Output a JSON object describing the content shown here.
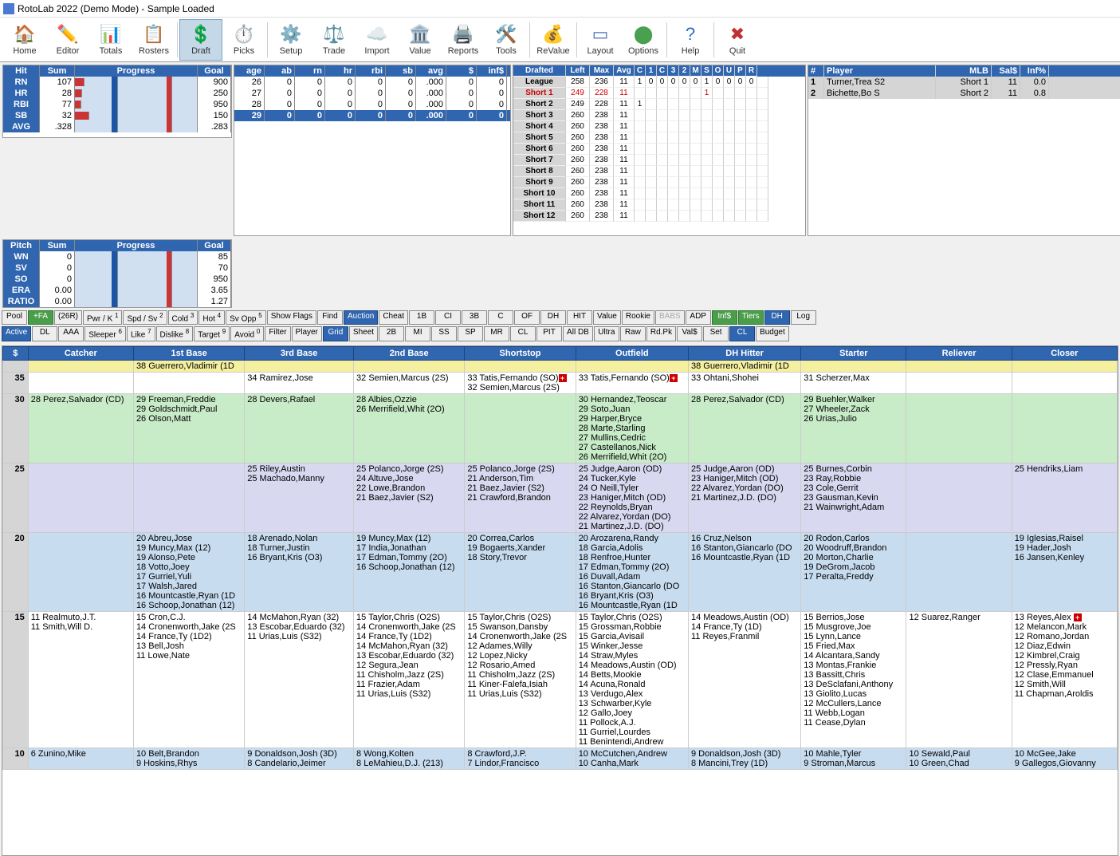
{
  "title": "RotoLab 2022 (Demo Mode) - Sample Loaded",
  "toolbar": [
    "Home",
    "Editor",
    "Totals",
    "Rosters",
    "Draft",
    "Picks",
    "Setup",
    "Trade",
    "Import",
    "Value",
    "Reports",
    "Tools",
    "ReValue",
    "Layout",
    "Options",
    "Help",
    "Quit"
  ],
  "hit": {
    "hdr": [
      "Hit",
      "Sum",
      "Progress",
      "Goal"
    ],
    "rows": [
      {
        "l": "RN",
        "s": "107",
        "g": "900",
        "p": 8
      },
      {
        "l": "HR",
        "s": "28",
        "g": "250",
        "p": 6
      },
      {
        "l": "RBI",
        "s": "77",
        "g": "950",
        "p": 5
      },
      {
        "l": "SB",
        "s": "32",
        "g": "150",
        "p": 12
      },
      {
        "l": "AVG",
        "s": ".328",
        "g": ".283",
        "p": 0
      }
    ]
  },
  "pitch": {
    "hdr": [
      "Pitch",
      "Sum",
      "Progress",
      "Goal"
    ],
    "rows": [
      {
        "l": "WN",
        "s": "0",
        "g": "85"
      },
      {
        "l": "SV",
        "s": "0",
        "g": "70"
      },
      {
        "l": "SO",
        "s": "0",
        "g": "950"
      },
      {
        "l": "ERA",
        "s": "0.00",
        "g": "3.65"
      },
      {
        "l": "RATIO",
        "s": "0.00",
        "g": "1.27"
      }
    ]
  },
  "age": {
    "hdr": [
      "age",
      "ab",
      "rn",
      "hr",
      "rbi",
      "sb",
      "avg",
      "$",
      "inf$"
    ],
    "rows": [
      [
        "26",
        "0",
        "0",
        "0",
        "0",
        "0",
        ".000",
        "0",
        "0"
      ],
      [
        "27",
        "0",
        "0",
        "0",
        "0",
        "0",
        ".000",
        "0",
        "0"
      ],
      [
        "28",
        "0",
        "0",
        "0",
        "0",
        "0",
        ".000",
        "0",
        "0"
      ]
    ],
    "total": [
      "29",
      "0",
      "0",
      "0",
      "0",
      "0",
      ".000",
      "0",
      "0"
    ]
  },
  "draft": {
    "hdr": [
      "Drafted",
      "Left",
      "Max",
      "Avg",
      "C",
      "1",
      "C",
      "3",
      "2",
      "M",
      "S",
      "O",
      "U",
      "P",
      "R"
    ],
    "rows": [
      {
        "l": "League",
        "c": "",
        "v": [
          "258",
          "236",
          "11",
          "1",
          "0",
          "0",
          "0",
          "0",
          "0",
          "1",
          "0",
          "0",
          "0",
          "0",
          ""
        ]
      },
      {
        "l": "Short 1",
        "c": "short",
        "v": [
          "249",
          "228",
          "11",
          "",
          "",
          "",
          "",
          "",
          "",
          "1",
          "",
          "",
          "",
          "",
          ""
        ]
      },
      {
        "l": "Short 2",
        "c": "",
        "v": [
          "249",
          "228",
          "11",
          "1",
          "",
          "",
          "",
          "",
          "",
          "",
          "",
          "",
          "",
          "",
          ""
        ]
      },
      {
        "l": "Short 3",
        "c": "",
        "v": [
          "260",
          "238",
          "11",
          "",
          "",
          "",
          "",
          "",
          "",
          "",
          "",
          "",
          "",
          "",
          ""
        ]
      },
      {
        "l": "Short 4",
        "c": "",
        "v": [
          "260",
          "238",
          "11",
          "",
          "",
          "",
          "",
          "",
          "",
          "",
          "",
          "",
          "",
          "",
          ""
        ]
      },
      {
        "l": "Short 5",
        "c": "",
        "v": [
          "260",
          "238",
          "11",
          "",
          "",
          "",
          "",
          "",
          "",
          "",
          "",
          "",
          "",
          "",
          ""
        ]
      },
      {
        "l": "Short 6",
        "c": "",
        "v": [
          "260",
          "238",
          "11",
          "",
          "",
          "",
          "",
          "",
          "",
          "",
          "",
          "",
          "",
          "",
          ""
        ]
      },
      {
        "l": "Short 7",
        "c": "",
        "v": [
          "260",
          "238",
          "11",
          "",
          "",
          "",
          "",
          "",
          "",
          "",
          "",
          "",
          "",
          "",
          ""
        ]
      },
      {
        "l": "Short 8",
        "c": "",
        "v": [
          "260",
          "238",
          "11",
          "",
          "",
          "",
          "",
          "",
          "",
          "",
          "",
          "",
          "",
          "",
          ""
        ]
      },
      {
        "l": "Short 9",
        "c": "",
        "v": [
          "260",
          "238",
          "11",
          "",
          "",
          "",
          "",
          "",
          "",
          "",
          "",
          "",
          "",
          "",
          ""
        ]
      },
      {
        "l": "Short 10",
        "c": "",
        "v": [
          "260",
          "238",
          "11",
          "",
          "",
          "",
          "",
          "",
          "",
          "",
          "",
          "",
          "",
          "",
          ""
        ]
      },
      {
        "l": "Short 11",
        "c": "",
        "v": [
          "260",
          "238",
          "11",
          "",
          "",
          "",
          "",
          "",
          "",
          "",
          "",
          "",
          "",
          "",
          ""
        ]
      },
      {
        "l": "Short 12",
        "c": "",
        "v": [
          "260",
          "238",
          "11",
          "",
          "",
          "",
          "",
          "",
          "",
          "",
          "",
          "",
          "",
          "",
          ""
        ]
      }
    ]
  },
  "players": {
    "hdr": [
      "#",
      "Player",
      "MLB",
      "Sal$",
      "Inf%"
    ],
    "rows": [
      [
        "1",
        "Turner,Trea  S2",
        "Short 1",
        "11",
        "0.0"
      ],
      [
        "2",
        "Bichette,Bo  S",
        "Short 2",
        "11",
        "0.8"
      ]
    ]
  },
  "filters": {
    "r1": [
      {
        "t": "Pool",
        "c": ""
      },
      {
        "t": "+FA",
        "c": "green"
      },
      {
        "t": "(26R)",
        "c": ""
      },
      {
        "t": "Pwr / K",
        "c": "",
        "sup": "1"
      },
      {
        "t": "Spd / Sv",
        "c": "",
        "sup": "2"
      },
      {
        "t": "Cold",
        "c": "",
        "sup": "3"
      },
      {
        "t": "Hot",
        "c": "",
        "sup": "4"
      },
      {
        "t": "Sv Opp",
        "c": "",
        "sup": "5"
      },
      {
        "t": "Show Flags",
        "c": ""
      },
      {
        "t": "Find",
        "c": ""
      },
      {
        "t": "Auction",
        "c": "blue"
      },
      {
        "t": "Cheat",
        "c": ""
      },
      {
        "t": "1B",
        "c": ""
      },
      {
        "t": "CI",
        "c": ""
      },
      {
        "t": "3B",
        "c": ""
      },
      {
        "t": "C",
        "c": ""
      },
      {
        "t": "OF",
        "c": ""
      },
      {
        "t": "DH",
        "c": ""
      },
      {
        "t": "HIT",
        "c": ""
      },
      {
        "t": "Value",
        "c": ""
      },
      {
        "t": "Rookie",
        "c": ""
      },
      {
        "t": "BABS",
        "c": "dim"
      },
      {
        "t": "ADP",
        "c": ""
      },
      {
        "t": "Inf$",
        "c": "green"
      },
      {
        "t": "Tiers",
        "c": "green"
      },
      {
        "t": "DH",
        "c": "blue"
      },
      {
        "t": "Log",
        "c": ""
      }
    ],
    "r2": [
      {
        "t": "Active",
        "c": "blue"
      },
      {
        "t": "DL",
        "c": ""
      },
      {
        "t": "AAA",
        "c": ""
      },
      {
        "t": "Sleeper",
        "c": "",
        "sup": "6"
      },
      {
        "t": "Like",
        "c": "",
        "sup": "7"
      },
      {
        "t": "Dislike",
        "c": "",
        "sup": "8"
      },
      {
        "t": "Target",
        "c": "",
        "sup": "9"
      },
      {
        "t": "Avoid",
        "c": "",
        "sup": "0"
      },
      {
        "t": "Filter",
        "c": ""
      },
      {
        "t": "Player",
        "c": ""
      },
      {
        "t": "Grid",
        "c": "blue"
      },
      {
        "t": "Sheet",
        "c": ""
      },
      {
        "t": "2B",
        "c": ""
      },
      {
        "t": "MI",
        "c": ""
      },
      {
        "t": "SS",
        "c": ""
      },
      {
        "t": "SP",
        "c": ""
      },
      {
        "t": "MR",
        "c": ""
      },
      {
        "t": "CL",
        "c": ""
      },
      {
        "t": "PIT",
        "c": ""
      },
      {
        "t": "All DB",
        "c": ""
      },
      {
        "t": "Ultra",
        "c": ""
      },
      {
        "t": "Raw",
        "c": ""
      },
      {
        "t": "Rd.Pk",
        "c": ""
      },
      {
        "t": "Val$",
        "c": ""
      },
      {
        "t": "Set",
        "c": ""
      },
      {
        "t": "CL",
        "c": "blue"
      },
      {
        "t": "Budget",
        "c": ""
      }
    ]
  },
  "tiers": {
    "hdr": [
      "$",
      "Catcher",
      "1st Base",
      "3rd Base",
      "2nd Base",
      "Shortstop",
      "Outfield",
      "DH Hitter",
      "Starter",
      "Reliever",
      "Closer"
    ],
    "rows": [
      {
        "p": "",
        "cls": "bg-yel",
        "c": [
          "",
          "38 Guerrero,Vladimir (1D",
          "",
          "",
          "",
          "",
          "38 Guerrero,Vladimir (1D",
          "",
          "",
          ""
        ]
      },
      {
        "p": "35",
        "cls": "",
        "c": [
          "",
          "",
          "34 Ramirez,Jose",
          "32 Semien,Marcus (2S)",
          "33 Tatis,Fernando (SO)✚\n32 Semien,Marcus (2S)",
          "33 Tatis,Fernando (SO)✚",
          "33 Ohtani,Shohei",
          "31 Scherzer,Max",
          "",
          ""
        ]
      },
      {
        "p": "30",
        "cls": "bg-grn",
        "c": [
          "28 Perez,Salvador (CD)",
          "29 Freeman,Freddie\n29 Goldschmidt,Paul\n26 Olson,Matt",
          "28 Devers,Rafael",
          "28 Albies,Ozzie\n26 Merrifield,Whit (2O)",
          "",
          "30 Hernandez,Teoscar\n29 Soto,Juan\n29 Harper,Bryce\n28 Marte,Starling\n27 Mullins,Cedric\n27 Castellanos,Nick\n26 Merrifield,Whit (2O)",
          "28 Perez,Salvador (CD)",
          "29 Buehler,Walker\n27 Wheeler,Zack\n26 Urias,Julio",
          "",
          ""
        ]
      },
      {
        "p": "25",
        "cls": "bg-lav",
        "c": [
          "",
          "",
          "25 Riley,Austin\n25 Machado,Manny",
          "25 Polanco,Jorge (2S)\n24 Altuve,Jose\n22 Lowe,Brandon\n21 Baez,Javier (S2)",
          "25 Polanco,Jorge (2S)\n21 Anderson,Tim\n21 Baez,Javier (S2)\n21 Crawford,Brandon",
          "25 Judge,Aaron (OD)\n24 Tucker,Kyle\n24 O Neill,Tyler\n23 Haniger,Mitch (OD)\n22 Reynolds,Bryan\n22 Alvarez,Yordan (DO)\n21 Martinez,J.D. (DO)",
          "25 Judge,Aaron (OD)\n23 Haniger,Mitch (OD)\n22 Alvarez,Yordan (DO)\n21 Martinez,J.D. (DO)",
          "25 Burnes,Corbin\n23 Ray,Robbie\n23 Cole,Gerrit\n23 Gausman,Kevin\n21 Wainwright,Adam",
          "",
          "25 Hendriks,Liam"
        ]
      },
      {
        "p": "20",
        "cls": "bg-blu",
        "c": [
          "",
          "20 Abreu,Jose\n19 Muncy,Max (12)\n19 Alonso,Pete\n18 Votto,Joey\n17 Gurriel,Yuli\n17 Walsh,Jared\n16 Mountcastle,Ryan (1D\n16 Schoop,Jonathan (12)",
          "18 Arenado,Nolan\n18 Turner,Justin\n16 Bryant,Kris (O3)",
          "19 Muncy,Max (12)\n17 India,Jonathan\n17 Edman,Tommy (2O)\n16 Schoop,Jonathan (12)",
          "20 Correa,Carlos\n19 Bogaerts,Xander\n18 Story,Trevor",
          "20 Arozarena,Randy\n18 Garcia,Adolis\n18 Renfroe,Hunter\n17 Edman,Tommy (2O)\n16 Duvall,Adam\n16 Stanton,Giancarlo (DO\n16 Bryant,Kris (O3)\n16 Mountcastle,Ryan (1D",
          "16 Cruz,Nelson\n16 Stanton,Giancarlo (DO\n16 Mountcastle,Ryan (1D",
          "20 Rodon,Carlos\n20 Woodruff,Brandon\n20 Morton,Charlie\n19 DeGrom,Jacob\n17 Peralta,Freddy",
          "",
          "19 Iglesias,Raisel\n19 Hader,Josh\n16 Jansen,Kenley"
        ]
      },
      {
        "p": "15",
        "cls": "",
        "c": [
          "11 Realmuto,J.T.\n11 Smith,Will D.",
          "15 Cron,C.J.\n14 Cronenworth,Jake (2S\n14 France,Ty (1D2)\n13 Bell,Josh\n11 Lowe,Nate",
          "14 McMahon,Ryan (32)\n13 Escobar,Eduardo (32)\n11 Urias,Luis (S32)",
          "15 Taylor,Chris (O2S)\n14 Cronenworth,Jake (2S\n14 France,Ty (1D2)\n14 McMahon,Ryan (32)\n13 Escobar,Eduardo (32)\n12 Segura,Jean\n11 Chisholm,Jazz (2S)\n11 Frazier,Adam\n11 Urias,Luis (S32)",
          "15 Taylor,Chris (O2S)\n15 Swanson,Dansby\n14 Cronenworth,Jake (2S\n12 Adames,Willy\n12 Lopez,Nicky\n12 Rosario,Amed\n11 Chisholm,Jazz (2S)\n11 Kiner-Falefa,Isiah\n11 Urias,Luis (S32)",
          "15 Taylor,Chris (O2S)\n15 Grossman,Robbie\n15 Garcia,Avisail\n15 Winker,Jesse\n14 Straw,Myles\n14 Meadows,Austin (OD)\n14 Betts,Mookie\n14 Acuna,Ronald\n13 Verdugo,Alex\n13 Schwarber,Kyle\n12 Gallo,Joey\n11 Pollock,A.J.\n11 Gurriel,Lourdes\n11 Benintendi,Andrew",
          "14 Meadows,Austin (OD)\n14 France,Ty (1D)\n11 Reyes,Franmil",
          "15 Berrios,Jose\n15 Musgrove,Joe\n15 Lynn,Lance\n15 Fried,Max\n14 Alcantara,Sandy\n13 Montas,Frankie\n13 Bassitt,Chris\n13 DeSclafani,Anthony\n13 Giolito,Lucas\n12 McCullers,Lance\n11 Webb,Logan\n11 Cease,Dylan",
          "12 Suarez,Ranger",
          "13 Reyes,Alex ✚\n12 Melancon,Mark\n12 Romano,Jordan\n12 Diaz,Edwin\n12 Kimbrel,Craig\n12 Pressly,Ryan\n12 Clase,Emmanuel\n12 Smith,Will\n11 Chapman,Aroldis"
        ]
      },
      {
        "p": "10",
        "cls": "bg-blu",
        "c": [
          "6 Zunino,Mike",
          "10 Belt,Brandon\n9 Hoskins,Rhys",
          "9 Donaldson,Josh (3D)\n8 Candelario,Jeimer",
          "8 Wong,Kolten\n8 LeMahieu,D.J. (213)",
          "8 Crawford,J.P.\n7 Lindor,Francisco",
          "10 McCutchen,Andrew\n10 Canha,Mark",
          "9 Donaldson,Josh (3D)\n8 Mancini,Trey (1D)",
          "10 Mahle,Tyler\n9 Stroman,Marcus",
          "10 Sewald,Paul\n10 Green,Chad",
          "10 McGee,Jake\n9 Gallegos,Giovanny"
        ]
      }
    ]
  }
}
